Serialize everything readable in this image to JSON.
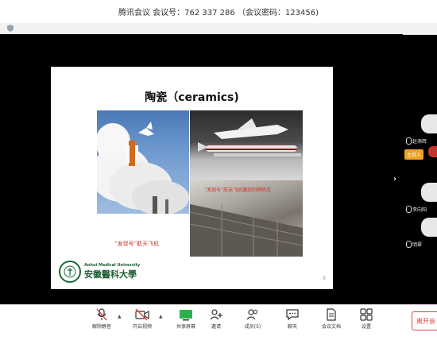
{
  "window": {
    "title": "腾讯会议 会议号：762 337 286 （会议密码：123456)"
  },
  "slide": {
    "title": "陶瓷（ceramics)",
    "caption_left": "“发现号”航天飞机",
    "caption_right": "“发现号”航天飞机腹部的隔热瓦",
    "university_en": "Anhui Medical University",
    "university_cn": "安徽醫科大學",
    "page_number": "5"
  },
  "participants": [
    {
      "name": "赵添辉",
      "muted": true
    },
    {
      "name": "主持人",
      "role_badge": true,
      "muted": true
    },
    {
      "name": "李向阳",
      "muted": true
    },
    {
      "name": "明翠",
      "muted": true
    }
  ],
  "toolbar": {
    "mute_label": "解除静音",
    "video_label": "开启视频",
    "share_label": "共享屏幕",
    "invite_label": "邀请",
    "members_label": "成员(5)",
    "chat_label": "聊天",
    "docs_label": "会议文档",
    "settings_label": "设置",
    "leave_label": "离开会"
  },
  "colors": {
    "accent_red": "#e04040",
    "host_badge": "#f0a020",
    "caption_red": "#c43a2e"
  }
}
